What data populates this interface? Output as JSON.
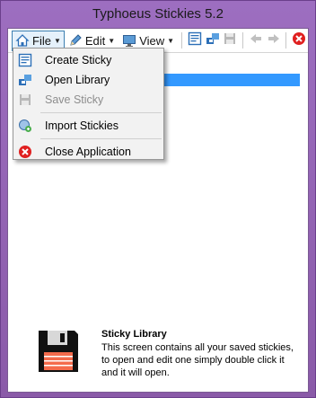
{
  "window": {
    "title": "Typhoeus Stickies 5.2"
  },
  "toolbar": {
    "file_label": "File",
    "edit_label": "Edit",
    "view_label": "View"
  },
  "file_menu": {
    "items": [
      {
        "label": "Create Sticky",
        "icon": "sticky-note-icon",
        "enabled": true
      },
      {
        "label": "Open Library",
        "icon": "open-library-icon",
        "enabled": true
      },
      {
        "label": "Save Sticky",
        "icon": "save-icon",
        "enabled": false
      },
      {
        "label": "Import Stickies",
        "icon": "import-icon",
        "enabled": true
      },
      {
        "label": "Close Application",
        "icon": "close-app-icon",
        "enabled": true
      }
    ]
  },
  "footer": {
    "title": "Sticky Library",
    "description": "This screen contains all your saved stickies, to open and edit one simply double click it and it will open."
  },
  "colors": {
    "frame": "#8a5aa8",
    "selection": "#3399ff",
    "close_red": "#e02020"
  }
}
